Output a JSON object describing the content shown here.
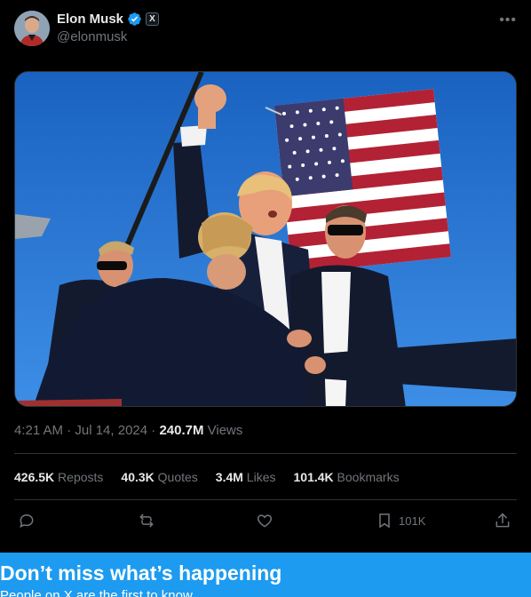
{
  "author": {
    "name": "Elon Musk",
    "handle": "@elonmusk",
    "badge": "X"
  },
  "meta": {
    "time": "4:21 AM · Jul 14, 2024 · ",
    "views_count": "240.7M",
    "views_label": " Views"
  },
  "stats": [
    {
      "count": "426.5K",
      "label": " Reposts"
    },
    {
      "count": "40.3K",
      "label": " Quotes"
    },
    {
      "count": "3.4M",
      "label": " Likes"
    },
    {
      "count": "101.4K",
      "label": " Bookmarks"
    }
  ],
  "actions": {
    "bookmark_count": "101K"
  },
  "banner": {
    "title": "Don’t miss what’s happening",
    "subtitle": "People on X are the first to know."
  },
  "colors": {
    "accent": "#1d9bf0",
    "background": "#000000",
    "muted": "#71767b",
    "divider": "#2f3336"
  },
  "icons": [
    "verified-icon",
    "more-icon",
    "reply-icon",
    "repost-icon",
    "like-icon",
    "bookmark-icon",
    "share-icon"
  ]
}
